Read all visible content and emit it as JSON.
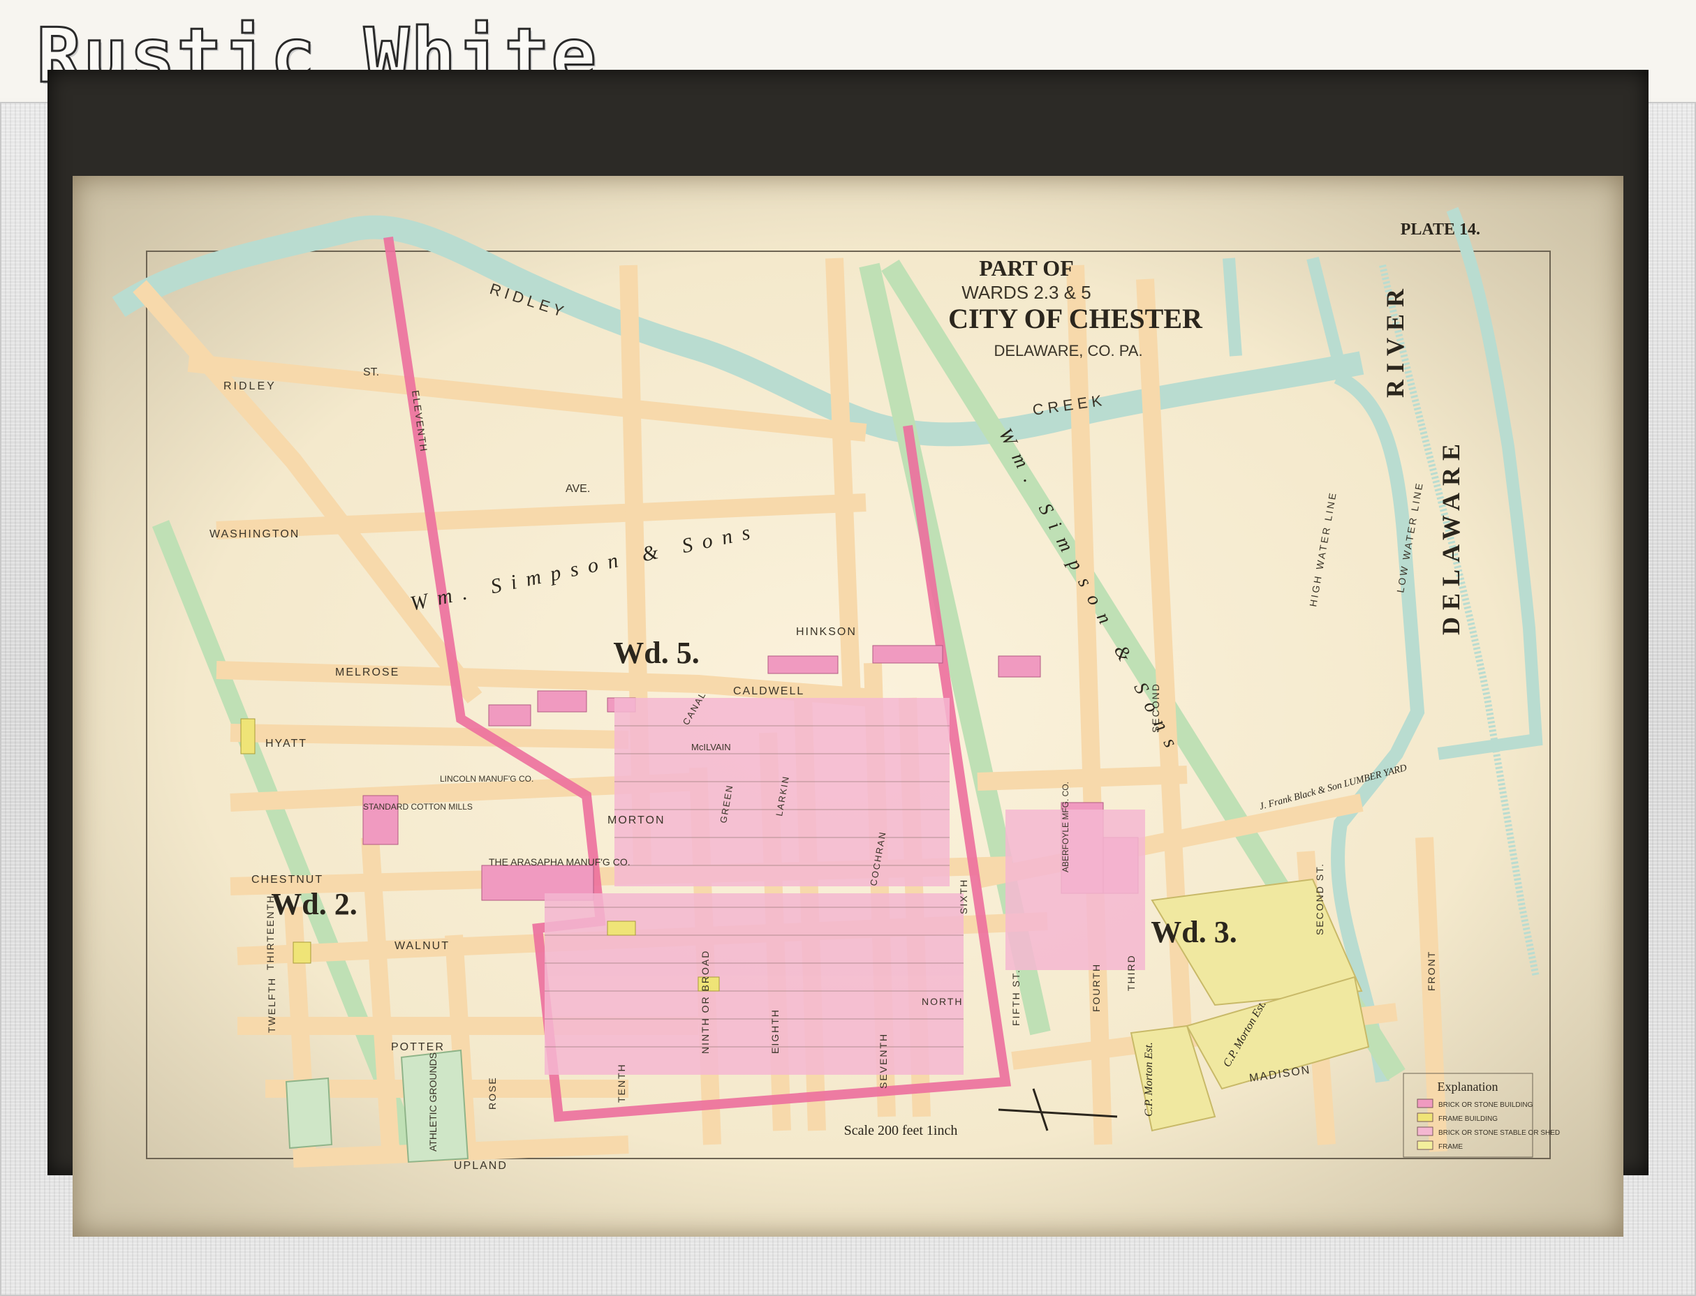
{
  "header": {
    "title": "Rustic White"
  },
  "map": {
    "plate": "PLATE 14.",
    "title_line1": "PART OF",
    "title_line2": "WARDS 2.3 & 5",
    "title_line3": "CITY OF CHESTER",
    "title_line4": "DELAWARE, CO. PA.",
    "scale": "Scale 200 feet 1inch",
    "wards": [
      "Wd. 2.",
      "Wd. 5.",
      "Wd. 3."
    ],
    "water_labels": [
      "RIDLEY",
      "CREEK",
      "DELAWARE",
      "RIVER",
      "HIGH WATER LINE",
      "LOW WATER LINE"
    ],
    "streets": [
      "RIDLEY",
      "ST.",
      "AVE.",
      "WASHINGTON",
      "MELROSE",
      "HYATT",
      "CHESTNUT",
      "WALNUT",
      "POTTER",
      "UPLAND",
      "MORTON",
      "CALDWELL",
      "HINKSON",
      "MADISON",
      "ELEVENTH",
      "TWELFTH",
      "THIRTEENTH",
      "TENTH",
      "NINTH OR BROAD",
      "EIGHTH",
      "SEVENTH",
      "SIXTH",
      "FIFTH ST.",
      "FOURTH",
      "THIRD",
      "SECOND",
      "SECOND ST.",
      "FRONT",
      "CANAL",
      "GREEN",
      "LARKIN",
      "COCHRAN",
      "NORTH",
      "ROSE",
      "McILVAIN"
    ],
    "owners": [
      "Wm. Simpson & Sons",
      "Wm. Simpson & Sons",
      "THE ARASAPHA MANUF'G CO.",
      "STANDARD COTTON MILLS",
      "LINCOLN MANUF'G CO.",
      "ABERFOYLE MFG. CO.",
      "ATHLETIC GROUNDS",
      "J. Frank Black & Son LUMBER YARD",
      "C.P. Morton Est.",
      "C.P. Morton Est."
    ],
    "legend": {
      "title": "Explanation",
      "items": [
        "BRICK OR STONE BUILDING",
        "FRAME BUILDING",
        "BRICK OR STONE STABLE OR SHED",
        "FRAME"
      ]
    },
    "colors": {
      "paper": "#f4e9cc",
      "water": "#b9dcd0",
      "railroad": "#bfe0b5",
      "street": "#f7d9ab",
      "brick": "#f09ac0",
      "frame": "#efe477",
      "ward_boundary": "#ec6f9d"
    }
  }
}
